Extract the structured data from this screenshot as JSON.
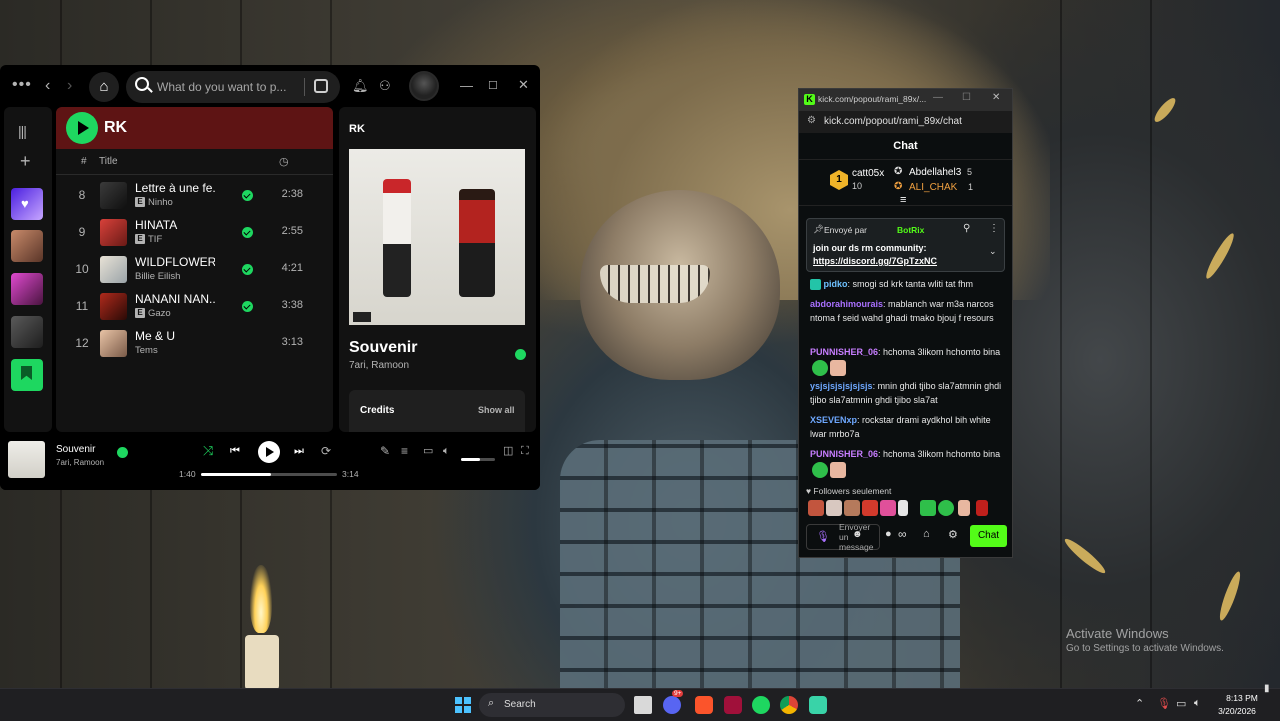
{
  "desktop": {
    "activate_title": "Activate Windows",
    "activate_sub": "Go to Settings to activate Windows."
  },
  "spotify": {
    "search_placeholder": "What do you want to p...",
    "playlist_title": "RK",
    "col_num": "#",
    "col_title": "Title",
    "tracks": [
      {
        "num": "8",
        "title": "Lettre à une fe...",
        "artist": "Ninho",
        "explicit": "E",
        "duration": "2:38",
        "saved": true
      },
      {
        "num": "9",
        "title": "HINATA",
        "artist": "TIF",
        "explicit": "E",
        "duration": "2:55",
        "saved": true
      },
      {
        "num": "10",
        "title": "WILDFLOWER",
        "artist": "Billie Eilish",
        "explicit": "",
        "duration": "4:21",
        "saved": true
      },
      {
        "num": "11",
        "title": "NANANI NAN...",
        "artist": "Gazo",
        "explicit": "E",
        "duration": "3:38",
        "saved": true
      },
      {
        "num": "12",
        "title": "Me & U",
        "artist": "Tems",
        "explicit": "",
        "duration": "3:13",
        "saved": false
      }
    ],
    "now_playing_panel": {
      "context": "RK",
      "song": "Souvenir",
      "artists": "7ari, Ramoon",
      "credits": "Credits",
      "show_all": "Show all"
    },
    "player": {
      "song": "Souvenir",
      "artists": "7ari, Ramoon",
      "elapsed": "1:40",
      "total": "3:14",
      "progress": 0.515,
      "volume": 0.55
    }
  },
  "kick": {
    "window_title": "kick.com/popout/rami_89x/...",
    "address": "kick.com/popout/rami_89x/chat",
    "chat_header": "Chat",
    "leaderboard": [
      {
        "rank": "1",
        "name": "catt05x",
        "count": "10"
      },
      {
        "rank": "",
        "name": "Abdellahel3",
        "count": "5"
      },
      {
        "rank": "",
        "name": "ALI_CHAK",
        "count": "1"
      }
    ],
    "pinned": {
      "sent_by": "Envoyé par",
      "sender": "BotRix",
      "line1": "join our ds rm community:",
      "link": "https://discord.gg/7GpTzxNC"
    },
    "messages": [
      {
        "user": "pidko",
        "color": "#6ec1ff",
        "text": ": smogi sd krk tanta wliti tat fhm"
      },
      {
        "user": "abdorahimourais",
        "color": "#a970ff",
        "text": ": mablanch war m3a narcos ntoma f seid wahd ghadi tmako bjouj f resours"
      },
      {
        "user": "PUNNISHER_06",
        "color": "#c77dff",
        "text": ": hchoma 3likom hchomto bina"
      },
      {
        "user": "ysjsjsjsjsjsjsjs",
        "color": "#6ea8ff",
        "text": ": mnin ghdi tjibo sla7atmnin ghdi tjibo sla7atmnin ghdi tjibo sla7at"
      },
      {
        "user": "XSEVENxp",
        "color": "#6ea8ff",
        "text": ": rockstar drami aydkhol bih white lwar mrbo7a"
      },
      {
        "user": "PUNNISHER_06",
        "color": "#c77dff",
        "text": ": hchoma 3likom hchomto bina"
      }
    ],
    "followers_only": "Followers seulement",
    "input_placeholder": "Envoyer un message",
    "send_label": "Chat"
  },
  "taskbar": {
    "search_label": "Search",
    "time": "8:13 PM",
    "date": "3/20/2026",
    "discord_badge": "9+"
  },
  "colors": {
    "spotify_green": "#1ed760",
    "kick_green": "#53fc18",
    "playlist_header": "#5e1414"
  }
}
